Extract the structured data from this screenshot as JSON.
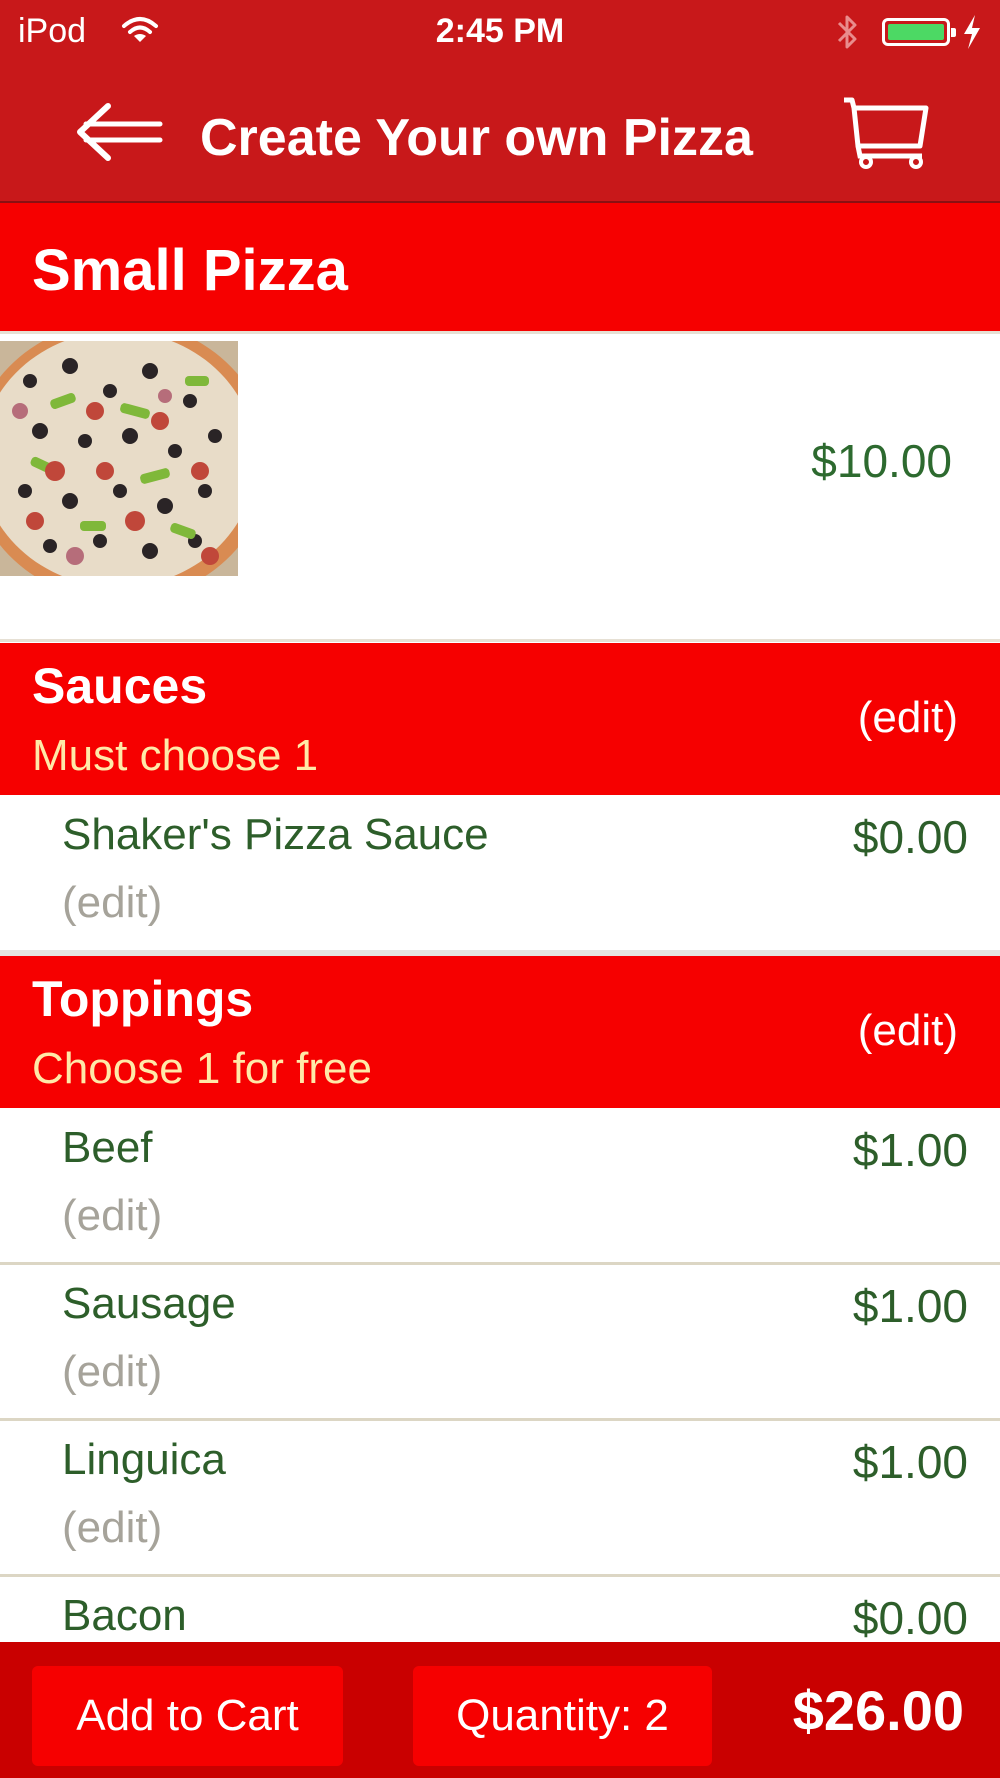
{
  "status_bar": {
    "carrier": "iPod",
    "time": "2:45 PM",
    "icons": [
      "wifi-icon",
      "bluetooth-icon",
      "battery-icon",
      "charging-bolt-icon"
    ],
    "battery_color": "#4cd964"
  },
  "nav": {
    "title": "Create Your own Pizza",
    "back_icon": "back-arrow-icon",
    "cart_icon": "cart-icon"
  },
  "product": {
    "name": "Small Pizza",
    "price": "$10.00",
    "image": "pizza-photo"
  },
  "sections": [
    {
      "title": "Sauces",
      "note": "Must choose 1",
      "edit_label": "(edit)",
      "items": [
        {
          "label": "Shaker's Pizza Sauce",
          "edit_label": "(edit)",
          "price": "$0.00"
        }
      ]
    },
    {
      "title": "Toppings",
      "note": "Choose 1 for free",
      "edit_label": "(edit)",
      "items": [
        {
          "label": "Beef",
          "edit_label": "(edit)",
          "price": "$1.00"
        },
        {
          "label": "Sausage",
          "edit_label": "(edit)",
          "price": "$1.00"
        },
        {
          "label": "Linguica",
          "edit_label": "(edit)",
          "price": "$1.00"
        },
        {
          "label": "Bacon",
          "price": "$0.00"
        }
      ]
    }
  ],
  "bottom_bar": {
    "add_to_cart_label": "Add to Cart",
    "quantity_label": "Quantity: 2",
    "total": "$26.00"
  },
  "colors": {
    "nav_red": "#c8181a",
    "header_red": "#f60000",
    "bottom_red": "#c90000",
    "item_green": "#2d5e2a",
    "note_yellow": "#ffe9a8",
    "edit_gray": "#a6a39a"
  }
}
